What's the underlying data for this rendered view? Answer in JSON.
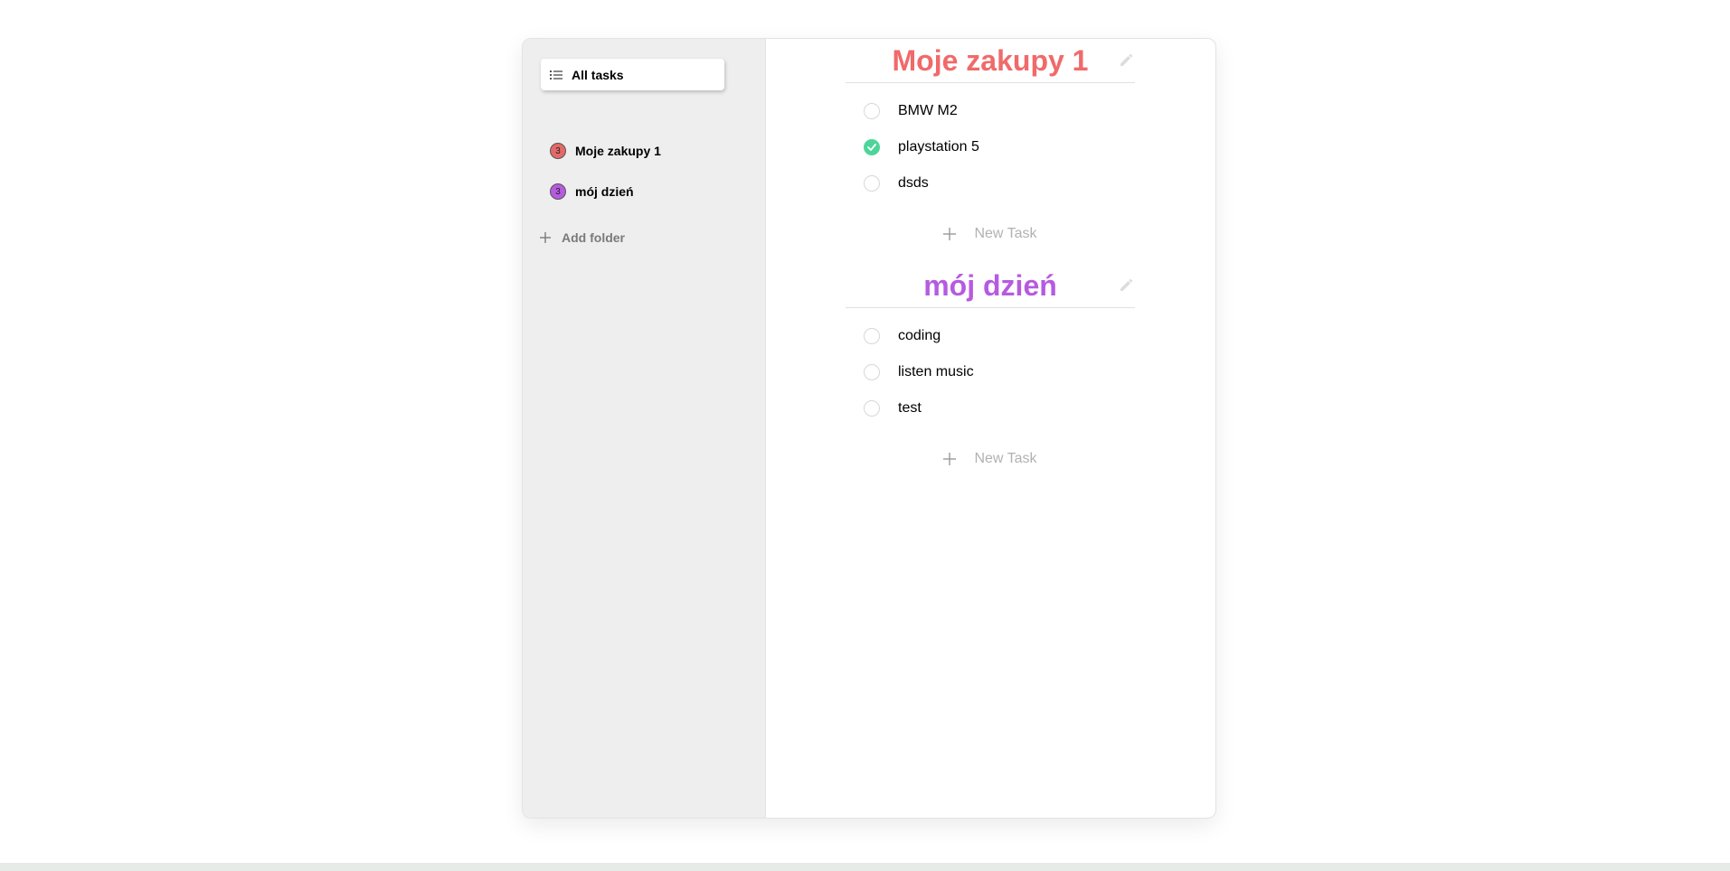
{
  "sidebar": {
    "all_tasks_label": "All tasks",
    "folders": [
      {
        "name": "Moje zakupy 1",
        "count": "3",
        "color": "#e56868"
      },
      {
        "name": "mój dzień",
        "count": "3",
        "color": "#b65be0"
      }
    ],
    "add_folder_label": "Add folder"
  },
  "main": {
    "folders": [
      {
        "title": "Moje zakupy 1",
        "color": "#f06a6a",
        "tasks": [
          {
            "text": "BMW M2",
            "done": false
          },
          {
            "text": "playstation 5",
            "done": true
          },
          {
            "text": "dsds",
            "done": false
          }
        ],
        "new_task_label": "New Task"
      },
      {
        "title": "mój dzień",
        "color": "#b65be0",
        "tasks": [
          {
            "text": "coding",
            "done": false
          },
          {
            "text": "listen music",
            "done": false
          },
          {
            "text": "test",
            "done": false
          }
        ],
        "new_task_label": "New Task"
      }
    ]
  },
  "colors": {
    "check_done": "#4dd599",
    "sidebar_bg": "#eeeeee"
  }
}
